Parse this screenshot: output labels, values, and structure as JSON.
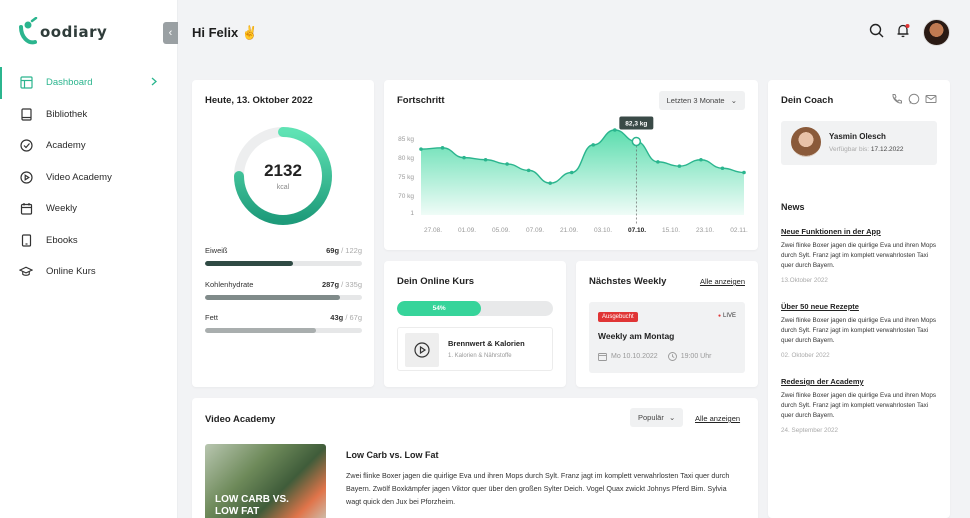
{
  "app": {
    "logo_text": "oodiary",
    "brand_color": "#2bb58e"
  },
  "sidebar": {
    "items": [
      {
        "label": "Dashboard",
        "icon": "layout-icon",
        "active": true
      },
      {
        "label": "Bibliothek",
        "icon": "book-icon"
      },
      {
        "label": "Academy",
        "icon": "check-circle-icon"
      },
      {
        "label": "Video Academy",
        "icon": "play-circle-icon"
      },
      {
        "label": "Weekly",
        "icon": "calendar-icon"
      },
      {
        "label": "Ebooks",
        "icon": "tablet-icon"
      },
      {
        "label": "Online Kurs",
        "icon": "graduation-cap-icon"
      }
    ]
  },
  "header": {
    "greeting": "Hi Felix ✌"
  },
  "today": {
    "title": "Heute, 13. Oktober 2022",
    "kcal": "2132",
    "unit": "kcal",
    "macros": [
      {
        "name": "Eiweiß",
        "value": "69g",
        "max": "/ 122g",
        "fraction": 0.56,
        "color": "#2f4a44"
      },
      {
        "name": "Kohlenhydrate",
        "value": "287g",
        "max": "/ 335g",
        "fraction": 0.86,
        "color": "#808b8a"
      },
      {
        "name": "Fett",
        "value": "43g",
        "max": "/ 67g",
        "fraction": 0.71,
        "color": "#a9aeae"
      }
    ]
  },
  "progress": {
    "title": "Fortschritt",
    "range": "Letzten 3 Monate",
    "tooltip": "82,3 kg"
  },
  "chart_data": {
    "type": "area",
    "title": "Fortschritt",
    "categories": [
      "27.08.",
      "01.09.",
      "05.09.",
      "07.09.",
      "21.09.",
      "03.10.",
      "07.10.",
      "15.10.",
      "23.10.",
      "02.11."
    ],
    "y_ticks": [
      "85 kg",
      "80 kg",
      "75 kg",
      "70 kg",
      "1"
    ],
    "ylim": [
      65,
      85
    ],
    "highlight_index": 6,
    "series": [
      {
        "values": [
          80.5,
          80.8,
          78.5,
          78.0,
          77.0,
          75.5,
          72.5,
          75.0,
          81.5,
          85.0,
          82.3,
          77.5,
          76.5,
          78.0,
          76.0,
          75.0
        ]
      }
    ]
  },
  "course": {
    "title": "Dein Online Kurs",
    "progress_label": "54%",
    "progress": 0.54,
    "item_title": "Brennwert & Kalorien",
    "item_sub": "1. Kalorien & Nährstoffe"
  },
  "weekly": {
    "title": "Nächstes Weekly",
    "link": "Alle anzeigen",
    "badge": "Ausgebucht",
    "live": "LIVE",
    "name": "Weekly am Montag",
    "date": "Mo 10.10.2022",
    "time": "19:00 Uhr"
  },
  "coach": {
    "title": "Dein Coach",
    "name": "Yasmin Olesch",
    "avail_label": "Verfügbar bis:",
    "avail_date": "17.12.2022"
  },
  "news": {
    "title": "News",
    "items": [
      {
        "title": "Neue Funktionen in der App",
        "text": "Zwei flinke Boxer jagen die quirlige Eva und ihren Mops durch Sylt. Franz jagt im komplett verwahrlosten Taxi quer durch Bayern.",
        "date": "13.Oktober 2022"
      },
      {
        "title": "Über 50 neue Rezepte",
        "text": "Zwei flinke Boxer jagen die quirlige Eva und ihren Mops durch Sylt. Franz jagt im komplett verwahrlosten Taxi quer durch Bayern.",
        "date": "02. Oktober 2022"
      },
      {
        "title": "Redesign der Academy",
        "text": "Zwei flinke Boxer jagen die quirlige Eva und ihren Mops durch Sylt. Franz jagt im komplett verwahrlosten Taxi quer durch Bayern.",
        "date": "24. September 2022"
      }
    ]
  },
  "video": {
    "title": "Video Academy",
    "sort": "Populär",
    "link": "Alle anzeigen",
    "thumb_label": "LOW CARB VS. LOW FAT",
    "item_title": "Low Carb vs. Low Fat",
    "item_desc": "Zwei flinke Boxer jagen die quirlige Eva und ihren Mops durch Sylt. Franz jagt im komplett verwahrlosten Taxi quer durch Bayern. Zwölf Boxkämpfer jagen Viktor quer über den großen Sylter Deich. Vogel Quax zwickt Johnys Pferd Bim. Sylvia wagt quick den Jux bei Pforzheim."
  }
}
